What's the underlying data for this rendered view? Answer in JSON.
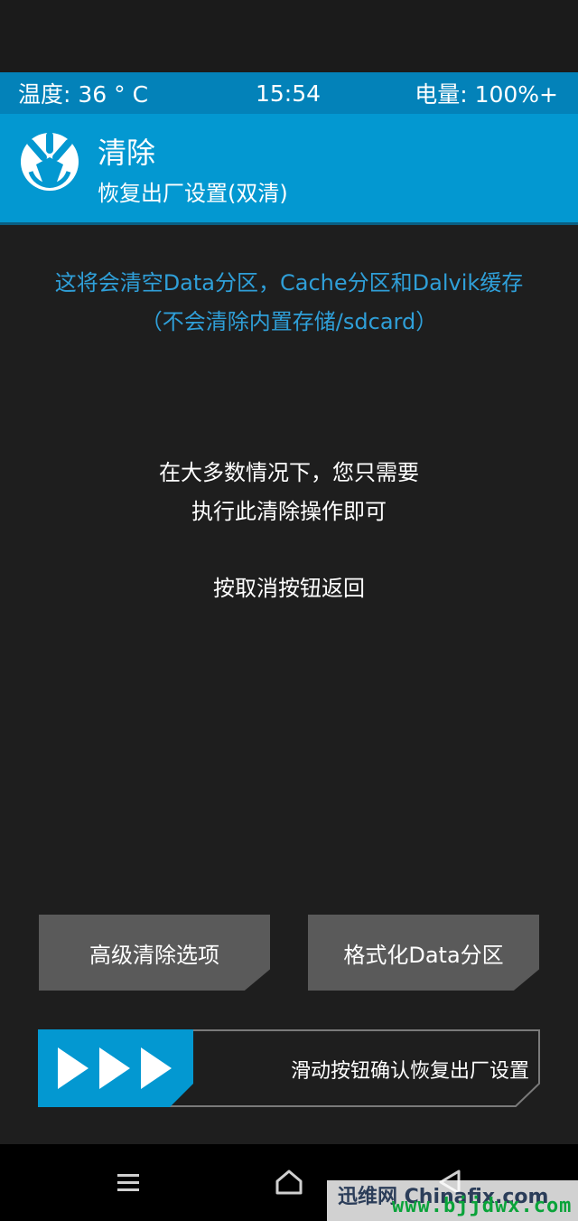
{
  "status_bar": {
    "temperature": "温度: 36 ° C",
    "time": "15:54",
    "battery": "电量: 100%+"
  },
  "header": {
    "title": "清除",
    "subtitle": "恢复出厂设置(双清)",
    "logo_icon": "twrp-logo-icon"
  },
  "notice": {
    "line1": "这将会清空Data分区，Cache分区和Dalvik缓存",
    "line2": "（不会清除内置存储/sdcard）"
  },
  "info": {
    "line1": "在大多数情况下，您只需要",
    "line2": "执行此清除操作即可",
    "back_hint": "按取消按钮返回"
  },
  "buttons": {
    "advanced_wipe": "高级清除选项",
    "format_data": "格式化Data分区"
  },
  "slider": {
    "label": "滑动按钮确认恢复出厂设置",
    "icon": "triple-arrow-icon"
  },
  "nav_bar": {
    "menu_icon": "menu-icon",
    "home_icon": "home-icon",
    "back_icon": "back-icon"
  },
  "watermark": {
    "top": "迅维网 Chinafix.com",
    "url": "www.bjjdwx.com"
  },
  "colors": {
    "status_bar": "#0382b9",
    "header": "#0398d1",
    "notice_text": "#2f9fd8",
    "background": "#1e1e1e",
    "button": "#5a5a5a",
    "slider_handle": "#0398d1"
  }
}
